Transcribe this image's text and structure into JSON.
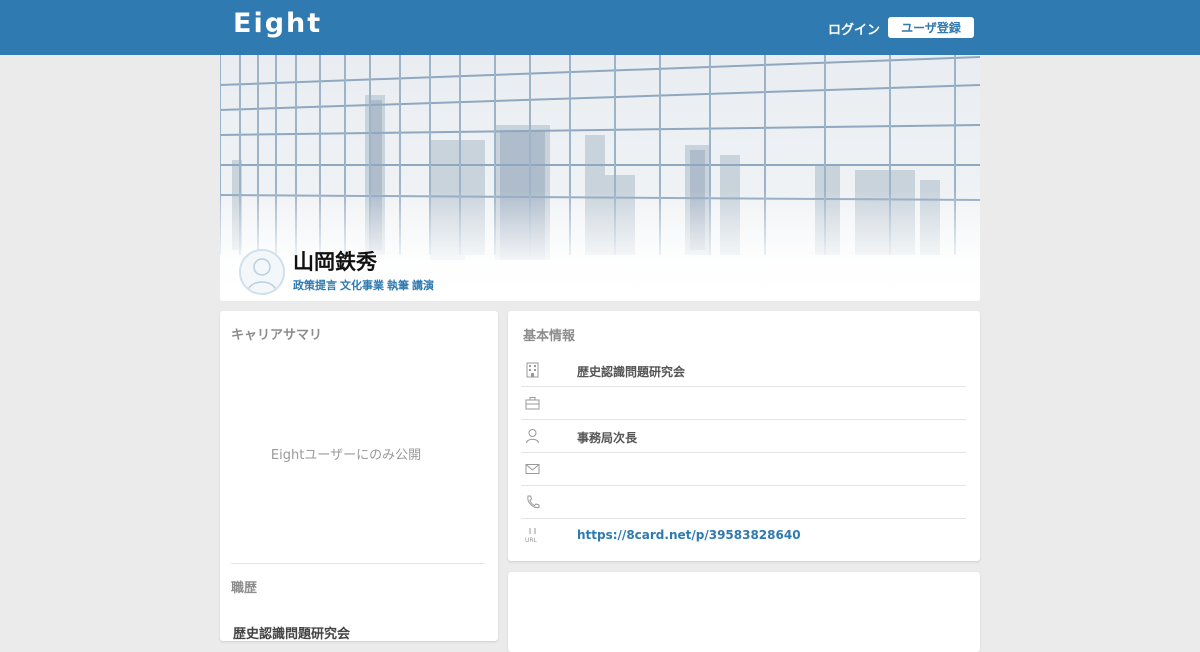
{
  "header": {
    "logo": "Eight",
    "login_label": "ログイン",
    "register_label": "ユーザ登録",
    "bar_color": "#2f7ab0"
  },
  "profile": {
    "name": "山岡鉄秀",
    "tags": [
      "政策提言",
      "文化事業",
      "執筆",
      "講演"
    ]
  },
  "career": {
    "title": "キャリアサマリ",
    "members_only_text": "Eightユーザーにのみ公開",
    "history_title": "職歴",
    "history_first": "歴史認識問題研究会"
  },
  "basic_info": {
    "title": "基本情報",
    "rows": [
      {
        "icon": "building-icon",
        "value": "歴史認識問題研究会"
      },
      {
        "icon": "briefcase-icon",
        "value": ""
      },
      {
        "icon": "person-icon",
        "value": "事務局次長"
      },
      {
        "icon": "mail-icon",
        "value": ""
      },
      {
        "icon": "phone-icon",
        "value": ""
      },
      {
        "icon": "url-icon",
        "value": "https://8card.net/p/39583828640"
      }
    ]
  }
}
